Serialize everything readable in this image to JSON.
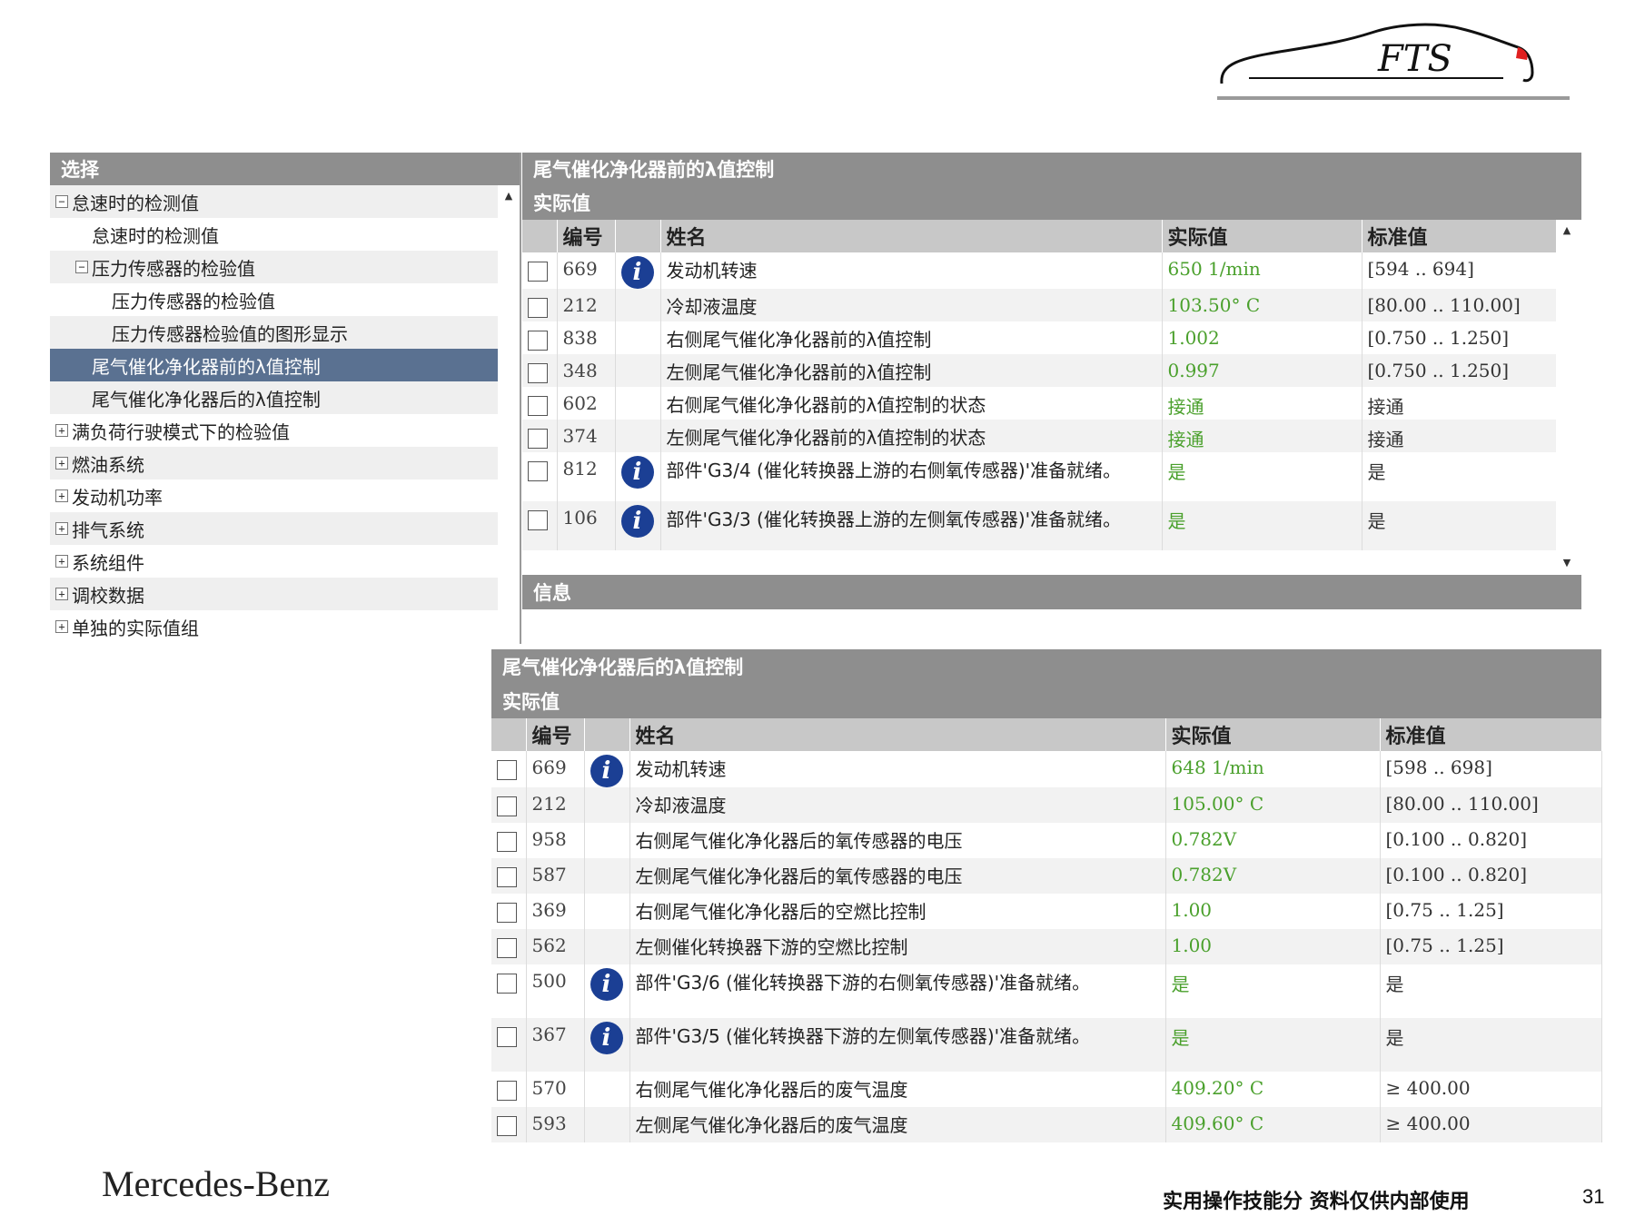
{
  "tree": {
    "header": "选择",
    "items": [
      {
        "label": "怠速时的检测值",
        "expander": "−",
        "indent": 0
      },
      {
        "label": "怠速时的检测值",
        "expander": "",
        "indent": 1
      },
      {
        "label": "压力传感器的检验值",
        "expander": "−",
        "indent": 1
      },
      {
        "label": "压力传感器的检验值",
        "expander": "",
        "indent": 2
      },
      {
        "label": "压力传感器检验值的图形显示",
        "expander": "",
        "indent": 2
      },
      {
        "label": "尾气催化净化器前的λ值控制",
        "expander": "",
        "indent": 1,
        "selected": true
      },
      {
        "label": "尾气催化净化器后的λ值控制",
        "expander": "",
        "indent": 1
      },
      {
        "label": "满负荷行驶模式下的检验值",
        "expander": "+",
        "indent": 0
      },
      {
        "label": "燃油系统",
        "expander": "+",
        "indent": 0
      },
      {
        "label": "发动机功率",
        "expander": "+",
        "indent": 0
      },
      {
        "label": "排气系统",
        "expander": "+",
        "indent": 0
      },
      {
        "label": "系统组件",
        "expander": "+",
        "indent": 0
      },
      {
        "label": "调校数据",
        "expander": "+",
        "indent": 0
      },
      {
        "label": "单独的实际值组",
        "expander": "+",
        "indent": 0
      }
    ]
  },
  "panel1": {
    "title": "尾气催化净化器前的λ值控制",
    "subtitle": "实际值",
    "columns": [
      "编号",
      "姓名",
      "实际值",
      "标准值"
    ],
    "rows": [
      {
        "id": "669",
        "info": true,
        "name": "发动机转速",
        "actual": "650 1/min",
        "std": "[594 .. 694]"
      },
      {
        "id": "212",
        "info": false,
        "name": "冷却液温度",
        "actual": "103.50° C",
        "std": "[80.00 .. 110.00]"
      },
      {
        "id": "838",
        "info": false,
        "name": "右侧尾气催化净化器前的λ值控制",
        "actual": "1.002",
        "std": "[0.750 .. 1.250]"
      },
      {
        "id": "348",
        "info": false,
        "name": "左侧尾气催化净化器前的λ值控制",
        "actual": "0.997",
        "std": "[0.750 .. 1.250]"
      },
      {
        "id": "602",
        "info": false,
        "name": "右侧尾气催化净化器前的λ值控制的状态",
        "actual": "接通",
        "std": "接通"
      },
      {
        "id": "374",
        "info": false,
        "name": "左侧尾气催化净化器前的λ值控制的状态",
        "actual": "接通",
        "std": "接通"
      },
      {
        "id": "812",
        "info": true,
        "name": "部件'G3/4 (催化转换器上游的右侧氧传感器)'准备就绪。",
        "actual": "是",
        "std": "是"
      },
      {
        "id": "106",
        "info": true,
        "name": "部件'G3/3 (催化转换器上游的左侧氧传感器)'准备就绪。",
        "actual": "是",
        "std": "是"
      }
    ],
    "info_label": "信息"
  },
  "panel2": {
    "title": "尾气催化净化器后的λ值控制",
    "subtitle": "实际值",
    "columns": [
      "编号",
      "姓名",
      "实际值",
      "标准值"
    ],
    "rows": [
      {
        "id": "669",
        "info": true,
        "name": "发动机转速",
        "actual": "648 1/min",
        "std": "[598 .. 698]"
      },
      {
        "id": "212",
        "info": false,
        "name": "冷却液温度",
        "actual": "105.00° C",
        "std": "[80.00 .. 110.00]"
      },
      {
        "id": "958",
        "info": false,
        "name": "右侧尾气催化净化器后的氧传感器的电压",
        "actual": "0.782V",
        "std": "[0.100 .. 0.820]"
      },
      {
        "id": "587",
        "info": false,
        "name": "左侧尾气催化净化器后的氧传感器的电压",
        "actual": "0.782V",
        "std": "[0.100 .. 0.820]"
      },
      {
        "id": "369",
        "info": false,
        "name": "右侧尾气催化净化器后的空燃比控制",
        "actual": "1.00",
        "std": "[0.75 .. 1.25]"
      },
      {
        "id": "562",
        "info": false,
        "name": "左侧催化转换器下游的空燃比控制",
        "actual": "1.00",
        "std": "[0.75 .. 1.25]"
      },
      {
        "id": "500",
        "info": true,
        "name": "部件'G3/6 (催化转换器下游的右侧氧传感器)'准备就绪。",
        "actual": "是",
        "std": "是"
      },
      {
        "id": "367",
        "info": true,
        "name": "部件'G3/5 (催化转换器下游的左侧氧传感器)'准备就绪。",
        "actual": "是",
        "std": "是"
      },
      {
        "id": "570",
        "info": false,
        "name": "右侧尾气催化净化器后的废气温度",
        "actual": "409.20° C",
        "std": "≥ 400.00"
      },
      {
        "id": "593",
        "info": false,
        "name": "左侧尾气催化净化器后的废气温度",
        "actual": "409.60° C",
        "std": "≥ 400.00"
      }
    ]
  },
  "icons": {
    "info": "info-icon",
    "logo": "car-silhouette-logo"
  },
  "logo_text": "FTS",
  "brand": "Mercedes-Benz",
  "footer_note": "实用操作技能分 资料仅供内部使用",
  "page_number": "31",
  "colors": {
    "header_gray": "#8e8e8e",
    "selected_blue": "#5a7191",
    "actual_green": "#4aa02c",
    "info_blue": "#1b3f94",
    "logo_red": "#e02020"
  }
}
